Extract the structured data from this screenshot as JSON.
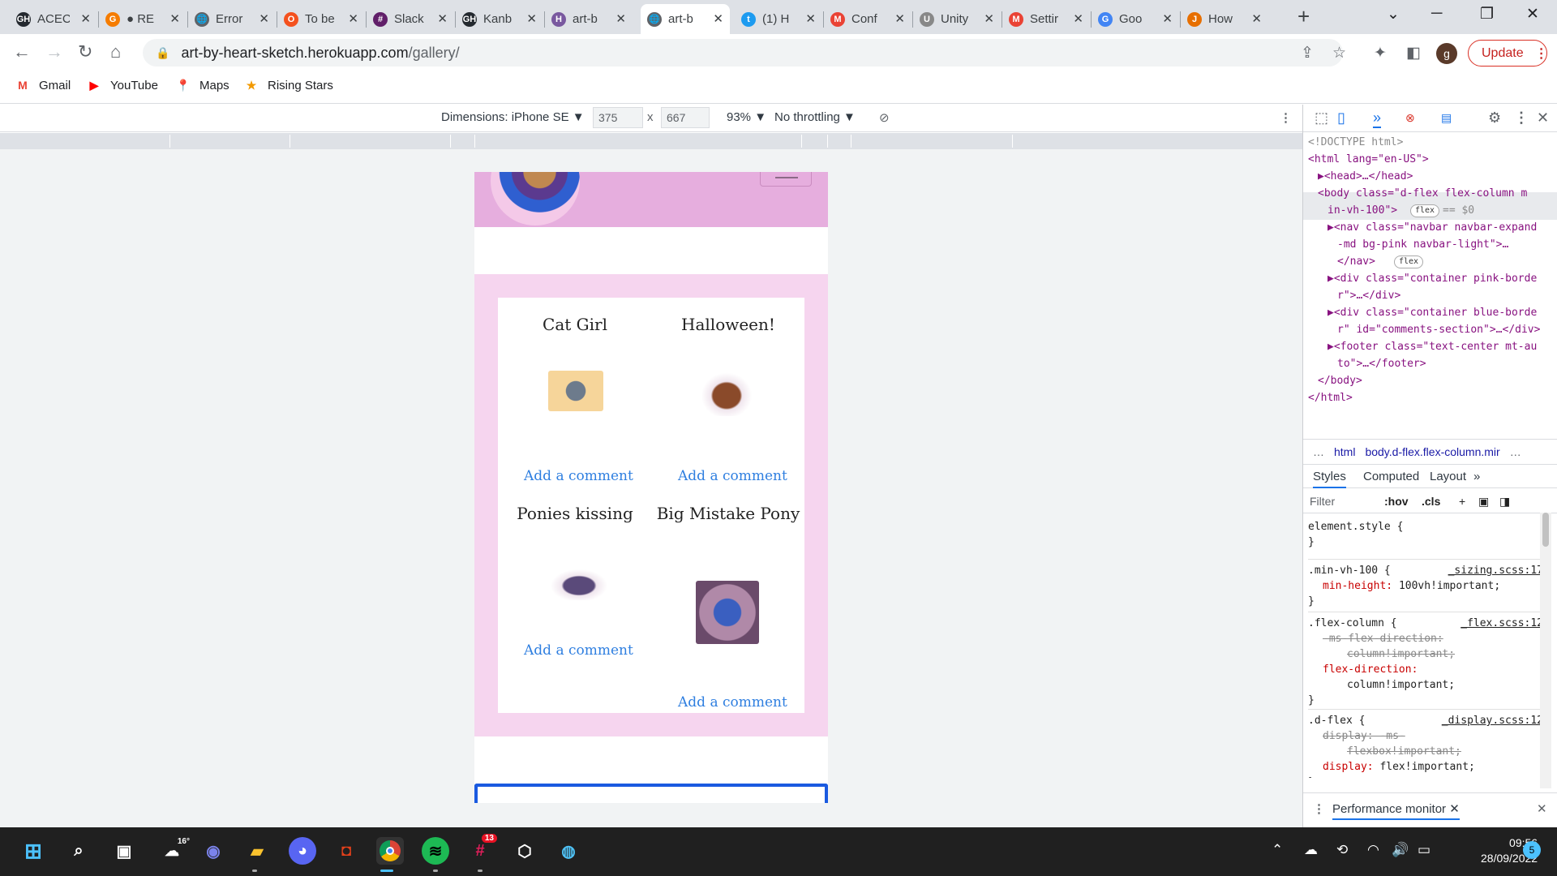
{
  "browser": {
    "tabs": [
      {
        "title": "ACEC",
        "fav": "GH",
        "favColor": "#24292f"
      },
      {
        "title": "● RE",
        "fav": "G",
        "favColor": "#f57c00"
      },
      {
        "title": "Error",
        "fav": "🌐",
        "favColor": "#5f6368"
      },
      {
        "title": "To be",
        "fav": "O",
        "favColor": "#f4511e"
      },
      {
        "title": "Slack",
        "fav": "#",
        "favColor": "#611f69"
      },
      {
        "title": "Kanb",
        "fav": "GH",
        "favColor": "#24292f"
      },
      {
        "title": "art-b",
        "fav": "H",
        "favColor": "#79589f"
      },
      {
        "title": "art-b",
        "fav": "🌐",
        "favColor": "#5f6368",
        "active": true
      },
      {
        "title": "(1) H",
        "fav": "t",
        "favColor": "#1d9bf0"
      },
      {
        "title": "Conf",
        "fav": "M",
        "favColor": "#ea4335"
      },
      {
        "title": "Unity",
        "fav": "U",
        "favColor": "#888888"
      },
      {
        "title": "Settir",
        "fav": "M",
        "favColor": "#ea4335"
      },
      {
        "title": "Goo",
        "fav": "G",
        "favColor": "#4285f4"
      },
      {
        "title": "How",
        "fav": "J",
        "favColor": "#e76f00"
      }
    ],
    "new_tab": "+",
    "url_host": "art-by-heart-sketch.herokuapp.com",
    "url_path": "/gallery/",
    "profile_initial": "g",
    "update_label": "Update",
    "bookmarks": [
      {
        "label": "Gmail",
        "icon": "M",
        "color": "#ea4335"
      },
      {
        "label": "YouTube",
        "icon": "▶",
        "color": "#ff0000"
      },
      {
        "label": "Maps",
        "icon": "📍",
        "color": "#34a853"
      },
      {
        "label": "Rising Stars",
        "icon": "★",
        "color": "#f29900"
      }
    ]
  },
  "device_toolbar": {
    "dimensions_label": "Dimensions: iPhone SE ▼",
    "width": "375",
    "times": "x",
    "height": "667",
    "zoom": "93% ▼",
    "throttling": "No throttling ▼"
  },
  "page": {
    "gallery": [
      {
        "title": "Cat Girl",
        "comment": "Add a comment",
        "thumb": "cat-girl",
        "color": "#f6d59a"
      },
      {
        "title": "Halloween!",
        "comment": "Add a comment",
        "thumb": "halloween",
        "color": "#8a4a2a"
      },
      {
        "title": "Ponies kissing",
        "comment": "Add a comment",
        "thumb": "ponies",
        "color": "#5a4a7a"
      },
      {
        "title": "Big Mistake Pony",
        "comment": "Add a comment",
        "thumb": "big-mistake-pony",
        "color": "#6a4a6a"
      }
    ]
  },
  "devtools": {
    "dom": [
      "<!DOCTYPE html>",
      "<html lang=\"en-US\">",
      "▶<head>…</head>",
      "<body class=\"d-flex flex-column m",
      "in-vh-100\">",
      "▶<nav class=\"navbar navbar-expand",
      "-md bg-pink navbar-light\">…",
      "</nav>",
      "▶<div class=\"container pink-borde",
      "r\">…</div>",
      "▶<div class=\"container blue-borde",
      "r\" id=\"comments-section\">…</div>",
      "▶<footer class=\"text-center mt-au",
      "to\">…</footer>",
      "</body>",
      "</html>"
    ],
    "pill_flex": "flex",
    "dollar0": "== $0",
    "crumbs": [
      "…",
      "html",
      "body.d-flex.flex-column.mir",
      "…"
    ],
    "style_tabs": [
      "Styles",
      "Computed",
      "Layout",
      "»"
    ],
    "filter_placeholder": "Filter",
    "hov": ":hov",
    "cls": ".cls",
    "rules": {
      "element_style": "element.style {",
      "close": "}",
      "r1_sel": ".min-vh-100 {",
      "r1_src": "_sizing.scss:17",
      "r1_prop": "min-height",
      "r1_val": "100vh!important;",
      "r2_sel": ".flex-column {",
      "r2_src": "_flex.scss:12",
      "r2_strike1": "-ms-flex-direction:",
      "r2_strike2": "column!important;",
      "r2_prop": "flex-direction",
      "r2_val": "column!important;",
      "r3_sel": ".d-flex {",
      "r3_src": "_display.scss:12",
      "r3_strike1": "display: -ms-",
      "r3_strike2": "flexbox!important;",
      "r3_prop": "display",
      "r3_val": "flex!important;"
    },
    "drawer_tab": "Performance monitor"
  },
  "taskbar": {
    "weather": "16°",
    "badge": "13",
    "time": "09:56",
    "date": "28/09/2022",
    "notif": "5"
  }
}
